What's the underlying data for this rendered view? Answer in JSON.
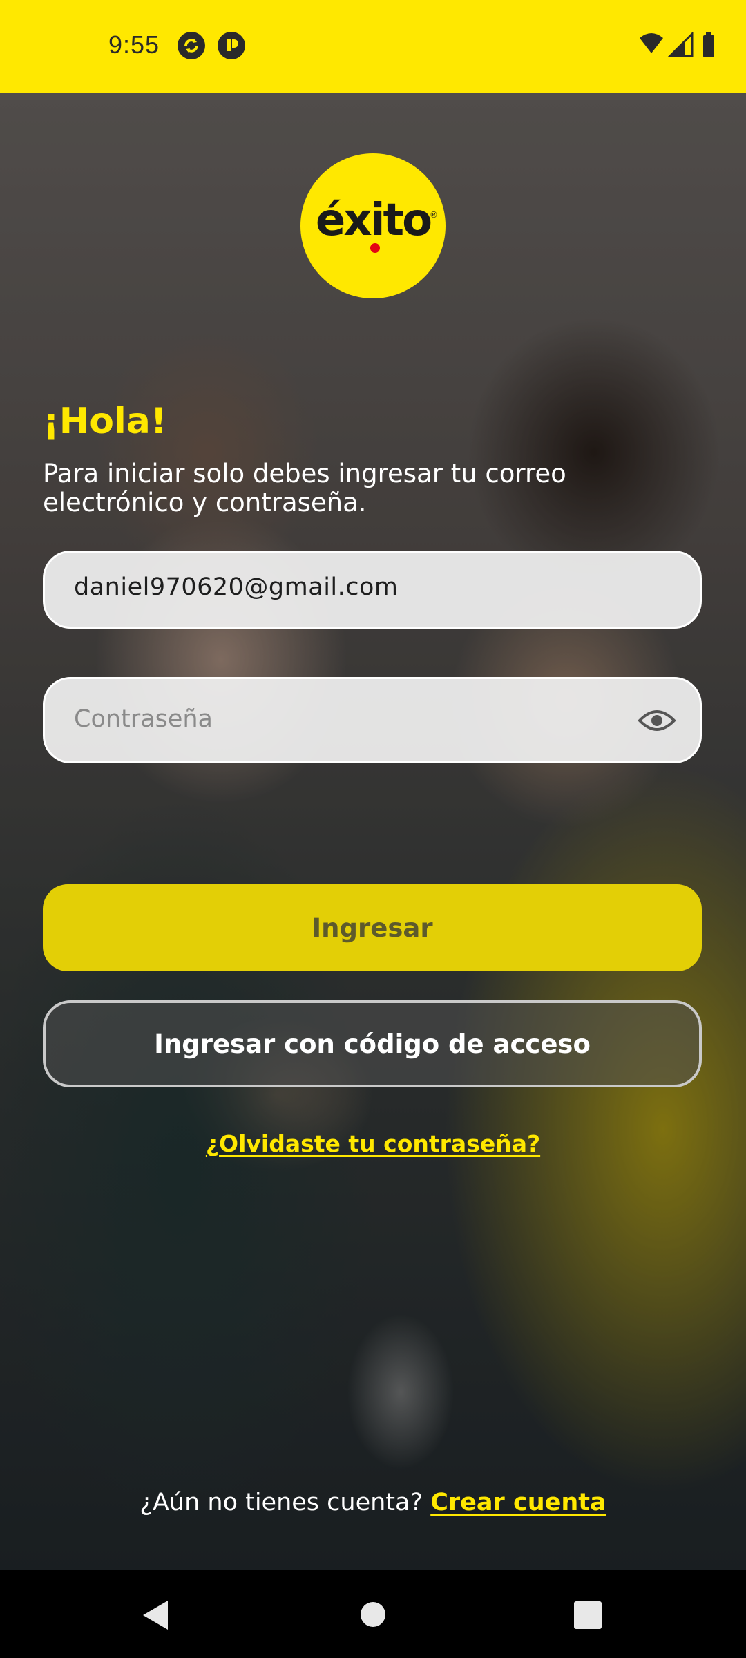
{
  "status_bar": {
    "time": "9:55",
    "icons": [
      "sync-icon",
      "app-notification-icon",
      "wifi-icon",
      "signal-icon",
      "battery-icon"
    ]
  },
  "brand": {
    "logo_text": "éxito",
    "accent_color": "#ffe800",
    "dot_color": "#e30613"
  },
  "login": {
    "greeting": "¡Hola!",
    "subtitle": "Para iniciar solo debes ingresar tu correo electrónico y contraseña.",
    "email_value": "daniel970620@gmail.com",
    "password_placeholder": "Contraseña",
    "login_button": "Ingresar",
    "code_button": "Ingresar con código de acceso",
    "forgot_password": "¿Olvidaste tu contraseña?",
    "signup_prompt": "¿Aún no tienes cuenta?",
    "signup_link": "Crear cuenta"
  },
  "nav_bar": {
    "icons": [
      "back-icon",
      "home-icon",
      "recents-icon"
    ]
  }
}
